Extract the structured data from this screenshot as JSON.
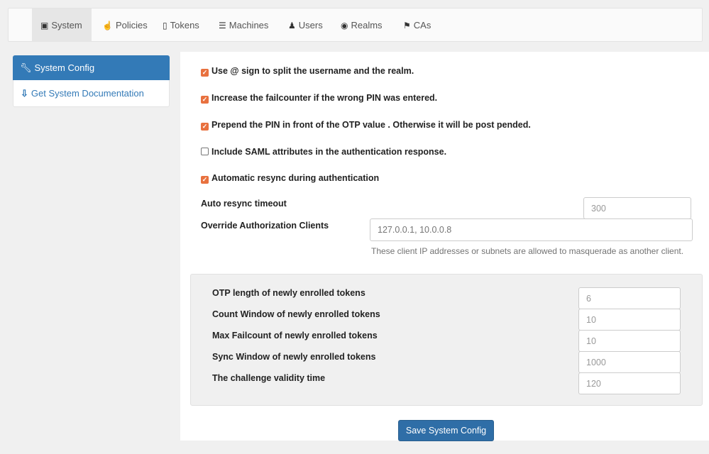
{
  "nav": {
    "tabs": [
      {
        "label": "System",
        "icon": "briefcase-icon",
        "active": true
      },
      {
        "label": "Policies",
        "icon": "hand-icon"
      },
      {
        "label": "Tokens",
        "icon": "phone-icon"
      },
      {
        "label": "Machines",
        "icon": "tasks-icon"
      },
      {
        "label": "Users",
        "icon": "user-icon"
      },
      {
        "label": "Realms",
        "icon": "globe-icon"
      },
      {
        "label": "CAs",
        "icon": "bookmark-icon"
      }
    ]
  },
  "sidebar": {
    "items": [
      {
        "label": "System Config",
        "icon": "wrench-icon",
        "active": true
      },
      {
        "label": "Get System Documentation",
        "icon": "download-circle-icon"
      }
    ]
  },
  "settings": {
    "checkboxes": [
      {
        "label": "Use @ sign to split the username and the realm.",
        "checked": true
      },
      {
        "label": "Increase the failcounter if the wrong PIN was entered.",
        "checked": true
      },
      {
        "label": "Prepend the PIN in front of the OTP value . Otherwise it will be post pended.",
        "checked": true
      },
      {
        "label": "Include SAML attributes in the authentication response.",
        "checked": false
      },
      {
        "label": "Automatic resync during authentication",
        "checked": true
      }
    ],
    "auto_resync_timeout": {
      "label": "Auto resync timeout",
      "value": "300"
    },
    "override_clients": {
      "label": "Override Authorization Clients",
      "placeholder": "127.0.0.1, 10.0.0.8",
      "help": "These client IP addresses or subnets are allowed to masquerade as another client."
    }
  },
  "token_defaults": [
    {
      "label": "OTP length of newly enrolled tokens",
      "value": "6"
    },
    {
      "label": "Count Window of newly enrolled tokens",
      "value": "10"
    },
    {
      "label": "Max Failcount of newly enrolled tokens",
      "value": "10"
    },
    {
      "label": "Sync Window of newly enrolled tokens",
      "value": "1000"
    },
    {
      "label": "The challenge validity time",
      "value": "120"
    }
  ],
  "save_button": {
    "label": "Save System Config"
  },
  "colors": {
    "primary": "#337ab7",
    "checkbox": "#e8713f"
  }
}
